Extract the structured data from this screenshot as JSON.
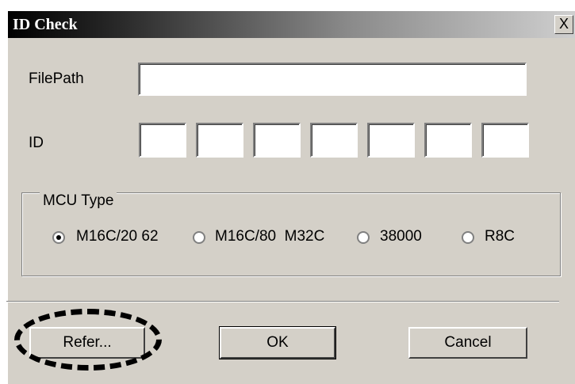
{
  "window": {
    "title": "ID Check",
    "close_glyph": "X"
  },
  "filepath": {
    "label": "FilePath",
    "value": ""
  },
  "id": {
    "label": "ID",
    "boxes": [
      "",
      "",
      "",
      "",
      "",
      "",
      ""
    ]
  },
  "mcu_type": {
    "legend": "MCU Type",
    "options": [
      {
        "label": "M16C/20 62",
        "selected": true
      },
      {
        "label": "M16C/80  M32C",
        "selected": false
      },
      {
        "label": "38000",
        "selected": false
      },
      {
        "label": "R8C",
        "selected": false
      }
    ]
  },
  "buttons": {
    "refer": "Refer...",
    "ok": "OK",
    "cancel": "Cancel"
  },
  "annotation": {
    "shape": "dashed-ellipse",
    "color": "#000000",
    "target": "refer-button"
  }
}
